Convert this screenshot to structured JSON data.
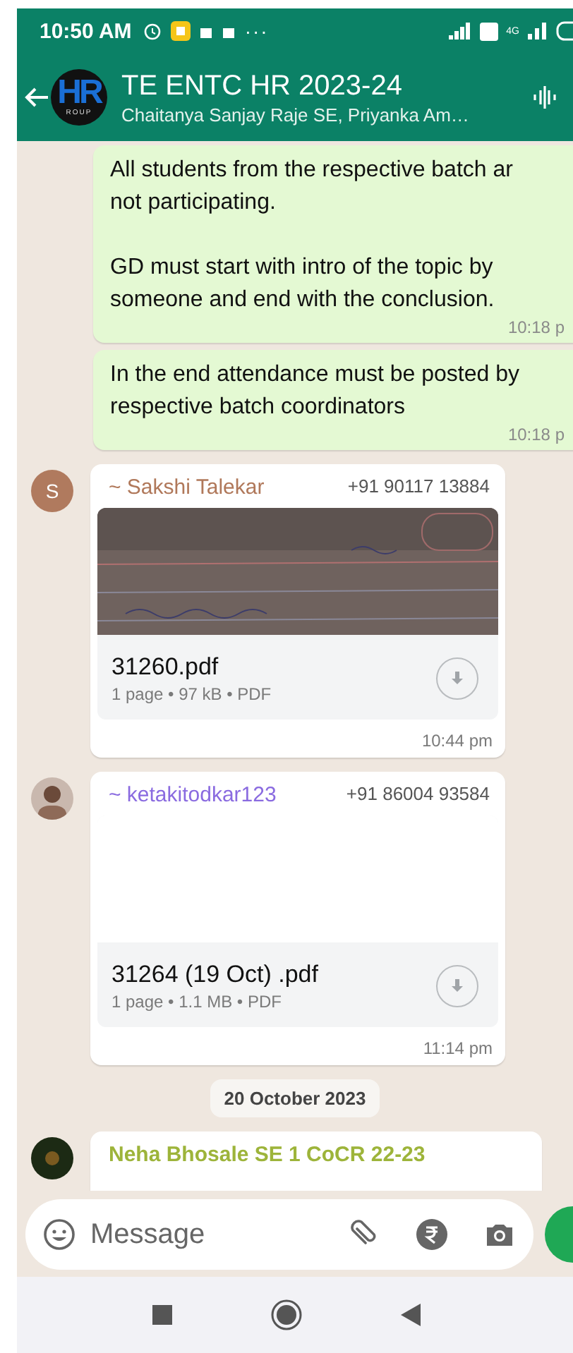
{
  "status_bar": {
    "time": "10:50 AM",
    "overflow": "···",
    "network": "4G"
  },
  "header": {
    "logo_text": "HR",
    "logo_caption": "ROUP",
    "title": "TE ENTC HR 2023-24",
    "subtitle": "Chaitanya Sanjay Raje SE, Priyanka Am…"
  },
  "messages": [
    {
      "kind": "outgoing",
      "text": "All students from the respective batch ar\nnot participating.\n\nGD must start with intro of the topic by\nsomeone and end with the conclusion.",
      "time": "10:18 p"
    },
    {
      "kind": "outgoing",
      "text": "In the end attendance must be posted by\nrespective batch coordinators",
      "time": "10:18 p"
    },
    {
      "kind": "document",
      "sender": "~ Sakshi Talekar",
      "color": "#b0785a",
      "phone": "+91 90117 13884",
      "avatar": {
        "kind": "letter",
        "letter": "S"
      },
      "file_name": "31260.pdf",
      "file_meta": "1 page • 97 kB • PDF",
      "time": "10:44 pm"
    },
    {
      "kind": "document",
      "sender": "~ ketakitodkar123",
      "color": "#8a6be0",
      "phone": "+91 86004 93584",
      "preview": {
        "kind": "blank"
      },
      "file_name": "31264 (19 Oct) .pdf",
      "file_meta": "1 page • 1.1 MB • PDF",
      "time": "11:14 pm"
    },
    {
      "kind": "date",
      "text": "20 October 2023"
    },
    {
      "kind": "deleted",
      "sender": "Neha Bhosale SE 1 CoCR 22-23",
      "color": "#9db43a",
      "avatar": {
        "kind": "photo-dark"
      }
    }
  ],
  "composer": {
    "placeholder": "Message"
  }
}
